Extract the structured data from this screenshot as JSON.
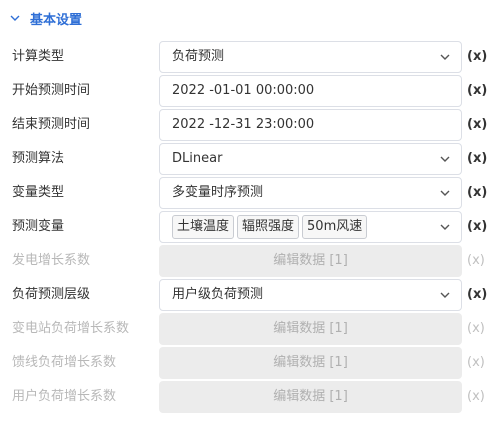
{
  "section": {
    "title": "基本设置",
    "icon": "chevron-down-icon",
    "accent_color": "#2f6fd6"
  },
  "fields": [
    {
      "label": "计算类型",
      "type": "select",
      "value": "负荷预测",
      "x": "(x)"
    },
    {
      "label": "开始预测时间",
      "type": "input",
      "value": "2022 -01-01 00:00:00",
      "x": "(x)"
    },
    {
      "label": "结束预测时间",
      "type": "input",
      "value": "2022 -12-31 23:00:00",
      "x": "(x)"
    },
    {
      "label": "预测算法",
      "type": "select",
      "value": "DLinear",
      "x": "(x)"
    },
    {
      "label": "变量类型",
      "type": "select",
      "value": "多变量时序预测",
      "x": "(x)"
    },
    {
      "label": "预测变量",
      "type": "multiselect",
      "tags": [
        "土壤温度",
        "辐照强度",
        "50m风速"
      ],
      "x": "(x)"
    },
    {
      "label": "发电增长系数",
      "type": "button",
      "button_label": "编辑数据 [1]",
      "disabled": true,
      "x": "(x)"
    },
    {
      "label": "负荷预测层级",
      "type": "select",
      "value": "用户级负荷预测",
      "x": "(x)"
    },
    {
      "label": "变电站负荷增长系数",
      "type": "button",
      "button_label": "编辑数据 [1]",
      "disabled": true,
      "x": "(x)"
    },
    {
      "label": "馈线负荷增长系数",
      "type": "button",
      "button_label": "编辑数据 [1]",
      "disabled": true,
      "x": "(x)"
    },
    {
      "label": "用户负荷增长系数",
      "type": "button",
      "button_label": "编辑数据 [1]",
      "disabled": true,
      "x": "(x)"
    }
  ]
}
